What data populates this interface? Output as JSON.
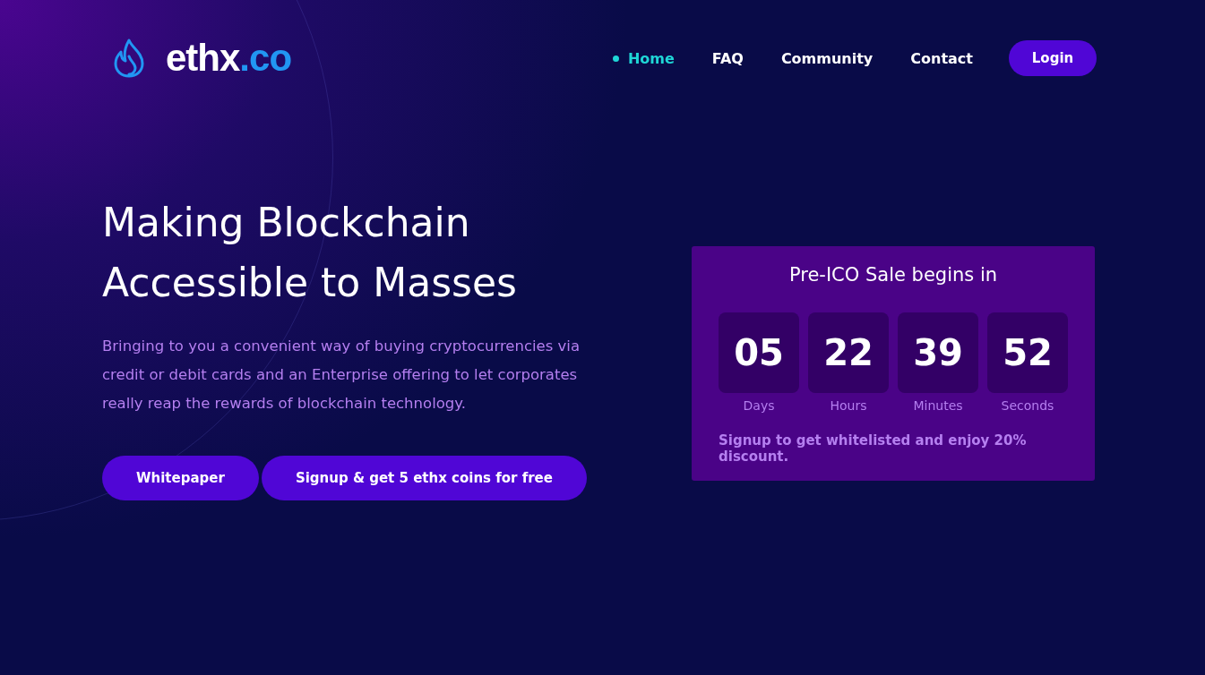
{
  "logo": {
    "name": "ethx",
    "suffix": ".co"
  },
  "nav": [
    {
      "label": "Home",
      "selected": true
    },
    {
      "label": "FAQ",
      "selected": false
    },
    {
      "label": "Community",
      "selected": false
    },
    {
      "label": "Contact",
      "selected": false
    }
  ],
  "login": "Login",
  "hero": {
    "title_lines": [
      "Making Blockchain",
      "Accessible to Masses"
    ],
    "description": "Bringing to you a convenient way of buying cryptocurrencies via credit or debit cards and an Enterprise offering to let corporates really reap the rewards of blockchain technology.",
    "buttons": [
      "Whitepaper",
      "Signup & get 5 ethx coins for free"
    ]
  },
  "countdown": {
    "title": "Pre-ICO Sale begins in",
    "units": [
      {
        "value": "05",
        "label": "Days"
      },
      {
        "value": "22",
        "label": "Hours"
      },
      {
        "value": "39",
        "label": "Minutes"
      },
      {
        "value": "52",
        "label": "Seconds"
      }
    ],
    "note": "Signup to get whitelisted and enjoy 20% discount."
  }
}
